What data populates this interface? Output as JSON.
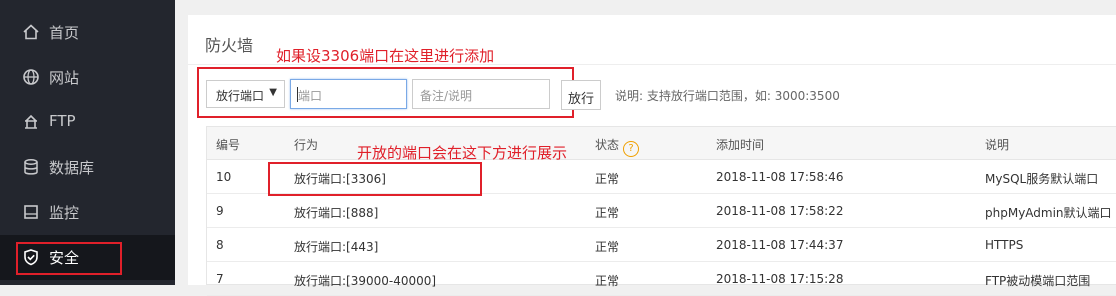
{
  "sidebar": {
    "items": [
      {
        "label": "首页",
        "icon": "home-icon"
      },
      {
        "label": "网站",
        "icon": "globe-icon"
      },
      {
        "label": "FTP",
        "icon": "ftp-icon"
      },
      {
        "label": "数据库",
        "icon": "database-icon"
      },
      {
        "label": "监控",
        "icon": "monitor-icon"
      },
      {
        "label": "安全",
        "icon": "shield-icon",
        "active": true
      }
    ]
  },
  "panel": {
    "title": "防火墙",
    "annotation_top": "如果设3306端口在这里进行添加",
    "annotation_table": "开放的端口会在这下方进行展示"
  },
  "form": {
    "select_value": "放行端口",
    "port_placeholder": "端口",
    "note_placeholder": "备注/说明",
    "submit_label": "放行",
    "hint": "说明: 支持放行端口范围，如: 3000:3500"
  },
  "table": {
    "headers": {
      "id": "编号",
      "action": "行为",
      "status": "状态",
      "time": "添加时间",
      "note": "说明"
    },
    "rows": [
      {
        "id": "10",
        "action": "放行端口:[3306]",
        "status": "正常",
        "time": "2018-11-08 17:58:46",
        "note": "MySQL服务默认端口"
      },
      {
        "id": "9",
        "action": "放行端口:[888]",
        "status": "正常",
        "time": "2018-11-08 17:58:22",
        "note": "phpMyAdmin默认端口"
      },
      {
        "id": "8",
        "action": "放行端口:[443]",
        "status": "正常",
        "time": "2018-11-08 17:44:37",
        "note": "HTTPS"
      },
      {
        "id": "7",
        "action": "放行端口:[39000-40000]",
        "status": "正常",
        "time": "2018-11-08 17:15:28",
        "note": "FTP被动模端口范围"
      }
    ]
  },
  "colors": {
    "annotation": "#e0202a",
    "sidebar_bg": "#23262e",
    "status_help": "#f0a000"
  }
}
